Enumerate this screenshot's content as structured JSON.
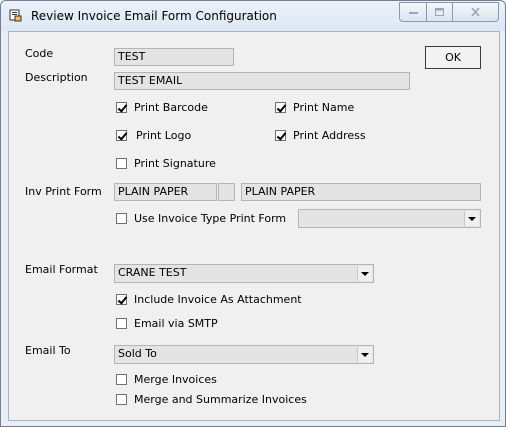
{
  "window": {
    "title": "Review Invoice Email Form Configuration"
  },
  "buttons": {
    "ok": "OK"
  },
  "labels": {
    "code": "Code",
    "description": "Description",
    "inv_print_form": "Inv Print Form",
    "email_format": "Email Format",
    "email_to": "Email To"
  },
  "fields": {
    "code": "TEST",
    "description": "TEST EMAIL",
    "inv_print_form_code": "PLAIN PAPER",
    "inv_print_form_desc": "PLAIN PAPER",
    "invoice_type_print_form": "",
    "email_format": "CRANE TEST",
    "email_to": "Sold To"
  },
  "checkboxes": {
    "print_barcode": {
      "label": "Print Barcode",
      "checked": true
    },
    "print_name": {
      "label": "Print Name",
      "checked": true
    },
    "print_logo": {
      "label": "Print Logo",
      "checked": true
    },
    "print_address": {
      "label": "Print Address",
      "checked": true
    },
    "print_signature": {
      "label": "Print Signature",
      "checked": false
    },
    "use_invoice_type_print_form": {
      "label": "Use Invoice Type Print Form",
      "checked": false
    },
    "include_invoice_attachment": {
      "label": "Include Invoice As Attachment",
      "checked": true
    },
    "email_via_smtp": {
      "label": "Email via SMTP",
      "checked": false
    },
    "merge_invoices": {
      "label": "Merge Invoices",
      "checked": false
    },
    "merge_summarize_invoices": {
      "label": "Merge and Summarize Invoices",
      "checked": false
    }
  },
  "icons": {
    "app": "form-app-icon",
    "dropdown": "chevron-down-icon"
  }
}
